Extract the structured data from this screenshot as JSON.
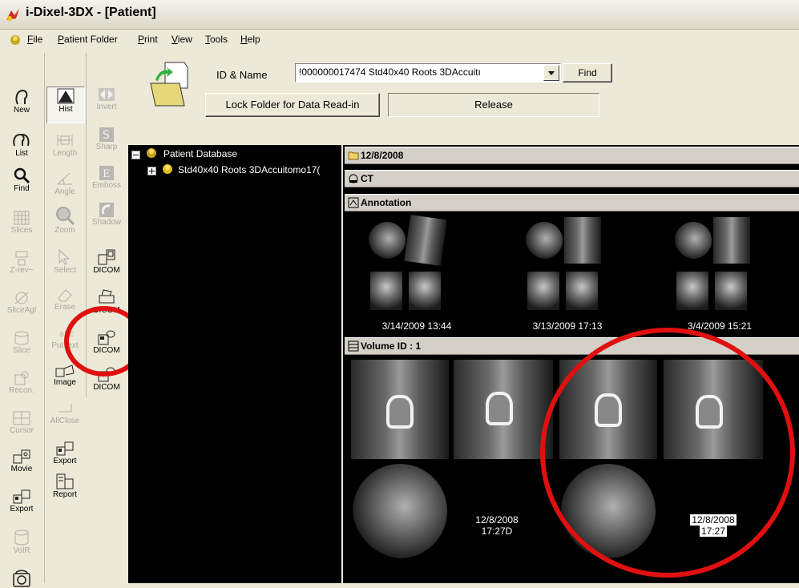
{
  "window": {
    "title": "i-Dixel-3DX - [Patient]"
  },
  "menu": [
    "File",
    "Patient Folder",
    "Print",
    "View",
    "Tools",
    "Help"
  ],
  "toolbar_col1": [
    "New",
    "List",
    "Find",
    "Slices",
    "Z-rev~",
    "SliceAgl",
    "Slice",
    "Recon.",
    "Cursor",
    "Movie",
    "Export",
    "VolR"
  ],
  "toolbar_col2": [
    "Hist",
    "Length",
    "Angle",
    "Zoom",
    "Select",
    "Erase",
    "PutText",
    "Image",
    "AllClose",
    "Export",
    "Report"
  ],
  "toolbar_col3": [
    "Invert",
    "Sharp",
    "Emboss",
    "Shadow",
    "DICOM",
    "DICOM",
    "DICOM",
    "DICOM"
  ],
  "header": {
    "id_label": "ID & Name",
    "id_value": "!000000017474 Std40x40 Roots 3DAccuitı",
    "find_label": "Find",
    "lock_label": "Lock Folder for Data Read-in",
    "release_label": "Release"
  },
  "tree": {
    "root": "Patient Database",
    "child": "Std40x40 Roots 3DAccuitomo17("
  },
  "gallery": {
    "date_header": "12/8/2008",
    "ct_header": "CT",
    "annotation_header": "Annotation",
    "annotation_dates": [
      "3/14/2009 13:44",
      "3/13/2009 17:13",
      "3/4/2009 15:21"
    ],
    "volume_header": "Volume ID : 1",
    "volume_dates": [
      [
        "12/8/2008",
        "17:27D"
      ],
      [
        "12/8/2008",
        "17:27"
      ]
    ]
  }
}
